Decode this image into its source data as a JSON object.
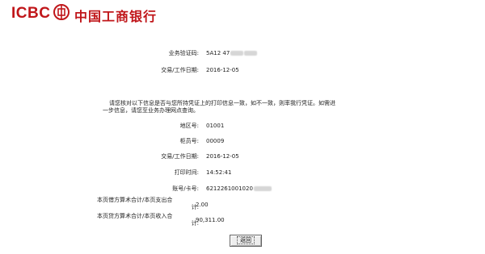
{
  "header": {
    "brand_en": "ICBC",
    "brand_cn": "中国工商银行",
    "brand_color": "#c0161a"
  },
  "summary": {
    "verify_code_label": "业务验证码:",
    "verify_code_value": "5A12 47",
    "trade_date_label": "交易/工作日期:",
    "trade_date_value": "2016-12-05"
  },
  "notice": {
    "line1": "请您核对以下信息是否与您所持凭证上的打印信息一致，如不一致，则率我行凭证。如需进",
    "line2": "一步信息，请您至业务办理网点查询。"
  },
  "details": {
    "region_label": "地区号:",
    "region_value": "01001",
    "teller_label": "柜员号:",
    "teller_value": "00009",
    "trade_date_label": "交易/工作日期:",
    "trade_date_value": "2016-12-05",
    "print_time_label": "打印时间:",
    "print_time_value": "14:52:41",
    "account_label": "账号/卡号:",
    "account_value": "6212261001020",
    "debit_label_1": "本页借方算术合计/本页支出合",
    "debit_label_2": "计:",
    "debit_value": "2.00",
    "credit_label_1": "本页贷方算术合计/本页收入合",
    "credit_label_2": "计:",
    "credit_value": "90,311.00"
  },
  "actions": {
    "back_label": "返回"
  }
}
